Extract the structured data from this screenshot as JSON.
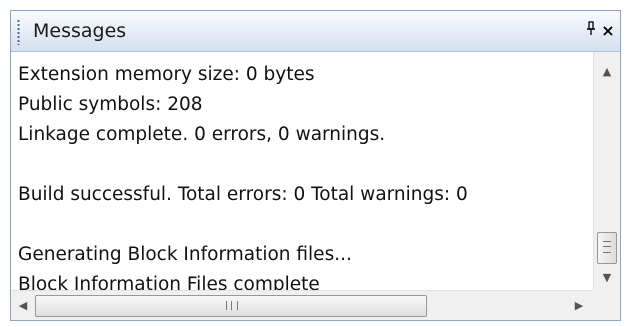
{
  "panel": {
    "title": "Messages",
    "pin_glyph": "Ԅ",
    "close_glyph": "×"
  },
  "messages": [
    "Extension memory size: 0 bytes",
    "Public symbols: 208",
    "Linkage complete. 0 errors, 0 warnings.",
    "",
    "Build successful.  Total errors: 0  Total warnings: 0",
    "",
    "Generating Block Information files...",
    "Block Information Files complete"
  ],
  "scrollbars": {
    "up_arrow": "▲",
    "down_arrow": "▼",
    "left_arrow": "◀",
    "right_arrow": "▶"
  },
  "icons": {
    "pin": "pin-icon",
    "close": "close-icon"
  }
}
